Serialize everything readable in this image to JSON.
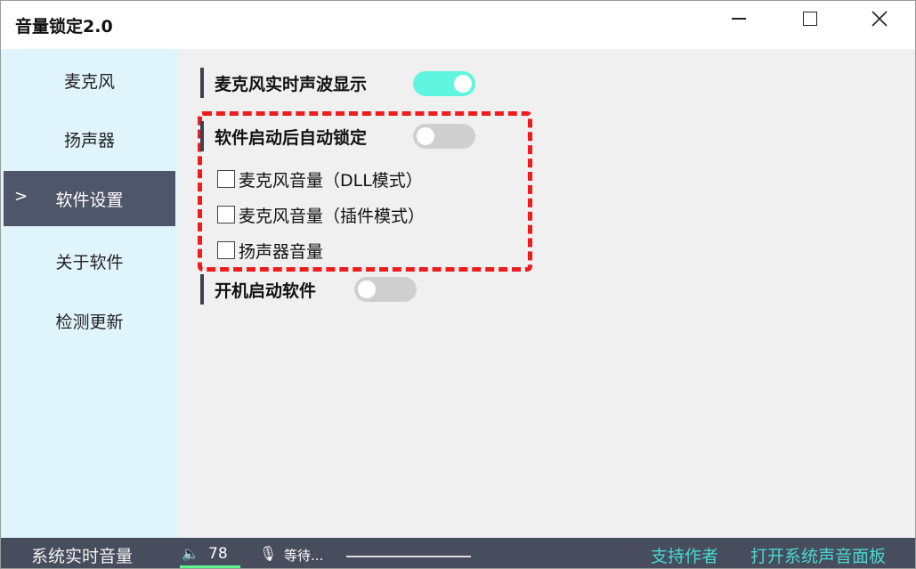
{
  "window": {
    "title": "音量锁定2.0",
    "controls": {
      "minimize": "minimize-icon",
      "maximize": "maximize-icon",
      "close": "✕"
    }
  },
  "sidebar": {
    "items": [
      {
        "label": "麦克风",
        "active": false
      },
      {
        "label": "扬声器",
        "active": false
      },
      {
        "label": "软件设置",
        "active": true,
        "marker": ">"
      },
      {
        "label": "关于软件",
        "active": false
      },
      {
        "label": "检测更新",
        "active": false
      }
    ]
  },
  "settings": {
    "mic_waveform": {
      "label": "麦克风实时声波显示",
      "on": true
    },
    "auto_lock": {
      "label": "软件启动后自动锁定",
      "on": false
    },
    "lock_options": [
      {
        "label": "麦克风音量（DLL模式）",
        "checked": false
      },
      {
        "label": "麦克风音量（插件模式）",
        "checked": false
      },
      {
        "label": "扬声器音量",
        "checked": false
      }
    ],
    "startup": {
      "label": "开机启动软件",
      "on": false
    }
  },
  "statusbar": {
    "title": "系统实时音量",
    "volume_icon": "🔈",
    "volume": "78",
    "mic_icon": "🎙",
    "mic_status": "等待...",
    "support_link": "支持作者",
    "panel_link": "打开系统声音面板"
  },
  "colors": {
    "sidebar_bg": "#e0f4fc",
    "active_nav": "#4f5669",
    "toggle_on": "#5ff5df",
    "toggle_off": "#cfcfcf",
    "highlight_dash": "#ee1c1c",
    "statusbar_bg": "#474d5d",
    "link": "#49d7d0",
    "volume_underline": "#5ef38f"
  }
}
